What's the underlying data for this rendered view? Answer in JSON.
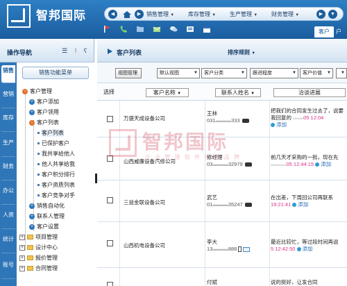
{
  "header": {
    "brand": "智邦国际",
    "nav_menus": [
      {
        "label": "销售管理"
      },
      {
        "label": "库存管理"
      },
      {
        "label": "生产管理"
      },
      {
        "label": "财务管理"
      }
    ],
    "tabs": [
      {
        "label": "客户"
      },
      {
        "label": "户"
      }
    ]
  },
  "sidebar": {
    "title": "操作导航",
    "vertical_tabs": [
      "销售",
      "营销",
      "库存",
      "生产",
      "财务",
      "办公",
      "人资",
      "统计",
      "账号"
    ],
    "function_button": "销售功能菜单",
    "tree": [
      {
        "label": "客户管理"
      },
      {
        "label": "客户添加"
      },
      {
        "label": "客户领用"
      },
      {
        "label": "客户列表"
      },
      {
        "label": "客户列表"
      },
      {
        "label": "已保护客户"
      },
      {
        "label": "我共享给他人"
      },
      {
        "label": "他人共享给我"
      },
      {
        "label": "客户积分排行"
      },
      {
        "label": "客户资质列表"
      },
      {
        "label": "客户竞争对手"
      },
      {
        "label": "销售自动化"
      },
      {
        "label": "联系人管理"
      },
      {
        "label": "客户设置"
      },
      {
        "label": "项目管理"
      },
      {
        "label": "设计中心"
      },
      {
        "label": "报价管理"
      },
      {
        "label": "合同管理"
      }
    ]
  },
  "main": {
    "title": "客户列表",
    "sort_label": "排序规则",
    "filters": {
      "view_button": "视图管理",
      "default_view": "默认视图",
      "category": "客户分类",
      "follow": "跟进程度",
      "value": "客户价值"
    },
    "columns": {
      "select": "选择",
      "name": "客户名称",
      "contact": "联系人姓名",
      "progress": "洽谈进展"
    },
    "rows": [
      {
        "company": "万盛天成设备公司",
        "contact": "王林",
        "phone": "031",
        "phone_tail": "333",
        "progress": "把我们的合同发生过去了，说要",
        "progress2": "我回复的",
        "date": "05 12:04",
        "add": "添加"
      },
      {
        "company": "山西威廉设备汽修公司",
        "contact": "修经理",
        "phone": "03",
        "phone_tail": "32979",
        "progress": "前几天才采购的一批，现在先",
        "progress2": "",
        "date": "05 12:44:15",
        "add": "添加"
      },
      {
        "company": "三益金联设备公司",
        "contact": "武艺",
        "phone": "01",
        "phone_tail": "35247",
        "progress": "在出差，下周回公司再联系",
        "progress2": "19:21:41",
        "date": "",
        "add": "添加"
      },
      {
        "company": "山西机电设备公司",
        "contact": "李大",
        "phone": "13",
        "phone_tail": "888",
        "progress": "最近比较忙，等过段时间再说",
        "progress2": "5 12:42:50",
        "date": "",
        "add": "添加"
      },
      {
        "company": "",
        "contact": "付斌",
        "phone": "",
        "phone_tail": "",
        "progress": "说的挺好，让发合同",
        "progress2": "",
        "date": "",
        "add": ""
      }
    ]
  },
  "watermark": {
    "text": "智邦国际",
    "sub": "企 业 管 理 软 件 领 先 品 牌"
  },
  "colors": {
    "header_blue": "#1a5d9f",
    "accent_pink": "#d9308a",
    "link_blue": "#2a6fb5"
  }
}
